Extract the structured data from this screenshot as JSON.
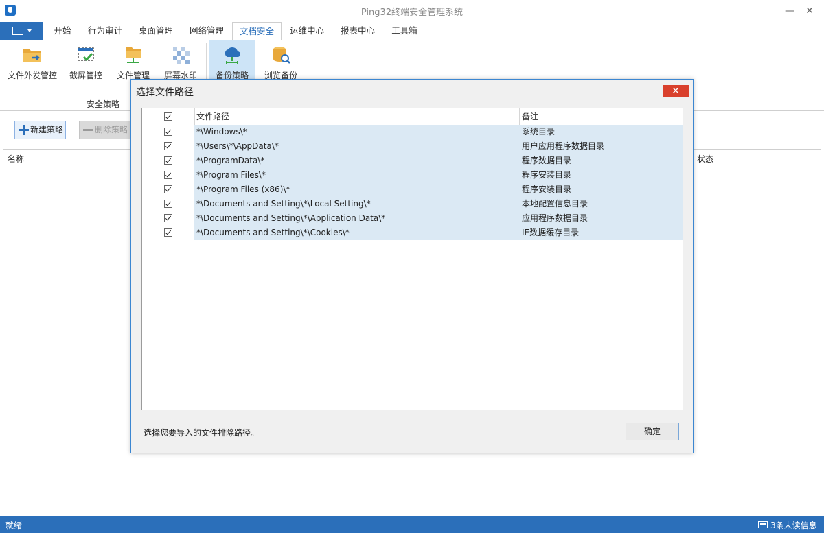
{
  "window": {
    "title": "Ping32终端安全管理系统",
    "minimize": "—",
    "close": "✕"
  },
  "tabs": [
    "开始",
    "行为审计",
    "桌面管理",
    "网络管理",
    "文档安全",
    "运维中心",
    "报表中心",
    "工具箱"
  ],
  "active_tab": "文档安全",
  "ribbon": {
    "buttons": [
      {
        "label": "文件外发管控",
        "icon": "folder-arrow-icon"
      },
      {
        "label": "截屏管控",
        "icon": "screenshot-check-icon"
      },
      {
        "label": "文件管理",
        "icon": "folder-network-icon"
      },
      {
        "label": "屏幕水印",
        "icon": "watermark-icon"
      },
      {
        "label": "备份策略",
        "icon": "cloud-backup-icon"
      },
      {
        "label": "浏览备份",
        "icon": "database-search-icon"
      }
    ],
    "selected": "备份策略",
    "group_label": "安全策略"
  },
  "toolbar": {
    "new_label": "新建策略",
    "delete_label": "删除策略"
  },
  "main_table": {
    "col_name": "名称",
    "col_status": "状态"
  },
  "dialog": {
    "title": "选择文件路径",
    "columns": {
      "path": "文件路径",
      "note": "备注"
    },
    "rows": [
      {
        "checked": true,
        "path": "*\\Windows\\*",
        "note": "系统目录"
      },
      {
        "checked": true,
        "path": "*\\Users\\*\\AppData\\*",
        "note": "用户应用程序数据目录"
      },
      {
        "checked": true,
        "path": "*\\ProgramData\\*",
        "note": "程序数据目录"
      },
      {
        "checked": true,
        "path": "*\\Program Files\\*",
        "note": "程序安装目录"
      },
      {
        "checked": true,
        "path": "*\\Program Files (x86)\\*",
        "note": "程序安装目录"
      },
      {
        "checked": true,
        "path": "*\\Documents and Setting\\*\\Local Setting\\*",
        "note": "本地配置信息目录"
      },
      {
        "checked": true,
        "path": "*\\Documents and Setting\\*\\Application Data\\*",
        "note": "应用程序数据目录"
      },
      {
        "checked": true,
        "path": "*\\Documents and Setting\\*\\Cookies\\*",
        "note": "IE数据缓存目录"
      }
    ],
    "hint": "选择您要导入的文件排除路径。",
    "ok_label": "确定",
    "close_glyph": "✕"
  },
  "status": {
    "text": "就绪",
    "unread": "3条未读信息"
  },
  "colors": {
    "accent": "#2b6fba",
    "selection": "#cde4f7",
    "row_highlight": "#dbe9f4",
    "close_red": "#d9402c"
  }
}
